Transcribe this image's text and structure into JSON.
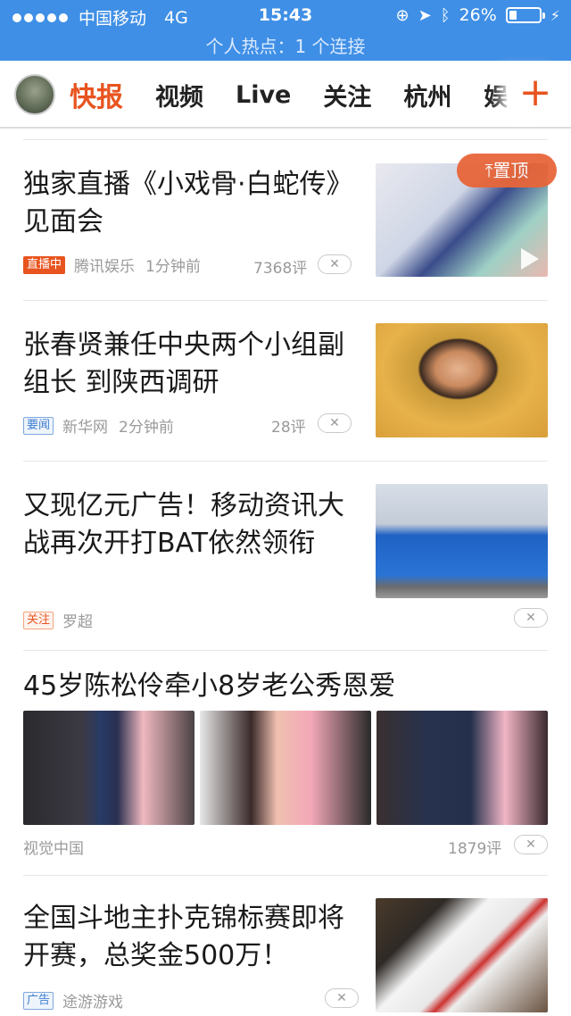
{
  "status_bar": {
    "carrier": "中国移动",
    "network": "4G",
    "time": "15:43",
    "battery": "26%",
    "battery_level": 0.26,
    "hotspot": "个人热点：1 个连接"
  },
  "nav": {
    "tabs": [
      "快报",
      "视频",
      "Live",
      "关注",
      "杭州",
      "娱"
    ],
    "add_label": "+"
  },
  "pinned_label": "置顶",
  "articles": [
    {
      "title": "独家直播《小戏骨·白蛇传》见面会",
      "badge": "直播中",
      "source": "腾讯娱乐",
      "time": "1分钟前",
      "comments": "7368评"
    },
    {
      "title": "张春贤兼任中央两个小组副组长 到陕西调研",
      "badge": "要闻",
      "source": "新华网",
      "time": "2分钟前",
      "comments": "28评"
    },
    {
      "title": "又现亿元广告！移动资讯大战再次开打BAT依然领衔",
      "badge": "关注",
      "source": "罗超",
      "time": "",
      "comments": ""
    },
    {
      "title": "45岁陈松伶牵小8岁老公秀恩爱",
      "badge": "",
      "source": "视觉中国",
      "time": "",
      "comments": "1879评"
    },
    {
      "title": "全国斗地主扑克锦标赛即将开赛，总奖金500万！",
      "badge": "广告",
      "source": "途游游戏",
      "time": "",
      "comments": ""
    }
  ],
  "colors": {
    "accent": "#e8541f",
    "status_bar": "#3f8fe6"
  }
}
